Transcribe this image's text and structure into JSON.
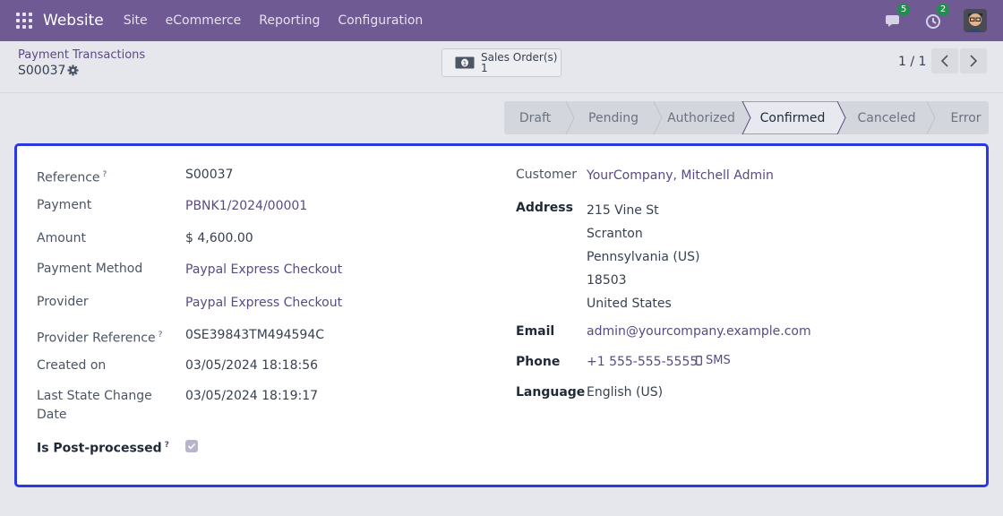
{
  "navbar": {
    "brand": "Website",
    "menu": [
      "Site",
      "eCommerce",
      "Reporting",
      "Configuration"
    ],
    "messages_count": "5",
    "activities_count": "2"
  },
  "control_panel": {
    "breadcrumb_parent": "Payment Transactions",
    "record_name": "S00037",
    "smart_button": {
      "label": "Sales Order(s)",
      "count": "1"
    },
    "pager": "1 / 1"
  },
  "statusbar": {
    "steps": [
      "Draft",
      "Pending",
      "Authorized",
      "Confirmed",
      "Canceled",
      "Error"
    ],
    "active": "Confirmed"
  },
  "form": {
    "left": {
      "reference": {
        "label": "Reference",
        "value": "S00037",
        "help": "?"
      },
      "payment": {
        "label": "Payment",
        "value": "PBNK1/2024/00001"
      },
      "amount": {
        "label": "Amount",
        "value": "$ 4,600.00"
      },
      "payment_method": {
        "label": "Payment Method",
        "value": "Paypal Express Checkout"
      },
      "provider": {
        "label": "Provider",
        "value": "Paypal Express Checkout"
      },
      "provider_reference": {
        "label": "Provider Reference",
        "value": "0SE39843TM494594C",
        "help": "?"
      },
      "created_on": {
        "label": "Created on",
        "value": "03/05/2024 18:18:56"
      },
      "last_state_change": {
        "label_line1": "Last State Change",
        "label_line2": "Date",
        "value": "03/05/2024 18:19:17"
      },
      "is_post_processed": {
        "label": "Is Post-processed",
        "help": "?",
        "checked": true
      }
    },
    "right": {
      "customer": {
        "label": "Customer",
        "value": "YourCompany, Mitchell Admin"
      },
      "address": {
        "label": "Address",
        "lines": [
          "215 Vine St",
          "Scranton",
          "Pennsylvania (US)",
          "18503",
          "United States"
        ]
      },
      "email": {
        "label": "Email",
        "value": "admin@yourcompany.example.com"
      },
      "phone": {
        "label": "Phone",
        "value": "+1 555-555-5555",
        "sms": "SMS"
      },
      "language": {
        "label": "Language",
        "value": "English (US)"
      }
    }
  },
  "colors": {
    "navbar": "#6f5a93",
    "link": "#5a4a84",
    "sheet_focus_border": "#2b38e0",
    "status_active_bg": "#e8e9f0"
  }
}
